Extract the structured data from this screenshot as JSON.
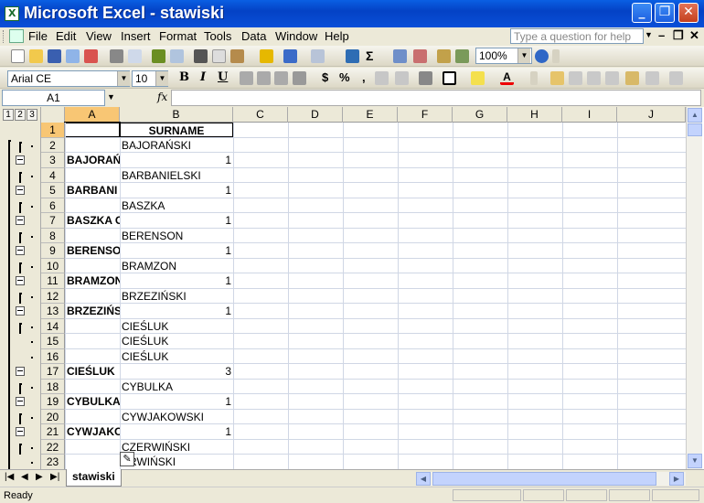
{
  "window": {
    "title": "Microsoft Excel - stawiski"
  },
  "menu": [
    "File",
    "Edit",
    "View",
    "Insert",
    "Format",
    "Tools",
    "Data",
    "Window",
    "Help"
  ],
  "help_placeholder": "Type a question for help",
  "toolbar": {
    "zoom": "100%",
    "font": "Arial CE",
    "size": "10",
    "bold": "B",
    "italic": "I",
    "underline": "U",
    "currency": "$",
    "percent": "%",
    "comma": ","
  },
  "formula": {
    "cell_ref": "A1",
    "fx": "fx",
    "value": ""
  },
  "outline_levels": [
    "1",
    "2",
    "3"
  ],
  "columns": [
    "A",
    "B",
    "C",
    "D",
    "E",
    "F",
    "G",
    "H",
    "I",
    "J"
  ],
  "rows": [
    {
      "n": "1",
      "a": "",
      "b": "SURNAME",
      "type": "header"
    },
    {
      "n": "2",
      "a": "",
      "b": "BAJORAŃSKI",
      "type": "detail"
    },
    {
      "n": "3",
      "a": "BAJORAŃ",
      "b": "1",
      "type": "total"
    },
    {
      "n": "4",
      "a": "",
      "b": "BARBANIELSKI",
      "type": "detail"
    },
    {
      "n": "5",
      "a": "BARBANI",
      "b": "1",
      "type": "total"
    },
    {
      "n": "6",
      "a": "",
      "b": "BASZKA",
      "type": "detail"
    },
    {
      "n": "7",
      "a": "BASZKA C",
      "b": "1",
      "type": "total"
    },
    {
      "n": "8",
      "a": "",
      "b": "BERENSON",
      "type": "detail"
    },
    {
      "n": "9",
      "a": "BERENSO",
      "b": "1",
      "type": "total"
    },
    {
      "n": "10",
      "a": "",
      "b": "BRAMZON",
      "type": "detail"
    },
    {
      "n": "11",
      "a": "BRAMZON",
      "b": "1",
      "type": "total"
    },
    {
      "n": "12",
      "a": "",
      "b": "BRZEZIŃSKI",
      "type": "detail"
    },
    {
      "n": "13",
      "a": "BRZEZIŃS",
      "b": "1",
      "type": "total"
    },
    {
      "n": "14",
      "a": "",
      "b": "CIEŚLUK",
      "type": "detail"
    },
    {
      "n": "15",
      "a": "",
      "b": "CIEŚLUK",
      "type": "detail"
    },
    {
      "n": "16",
      "a": "",
      "b": "CIEŚLUK",
      "type": "detail"
    },
    {
      "n": "17",
      "a": "CIEŚLUK",
      "b": "3",
      "type": "total"
    },
    {
      "n": "18",
      "a": "",
      "b": "CYBULKA",
      "type": "detail"
    },
    {
      "n": "19",
      "a": "CYBULKA",
      "b": "1",
      "type": "total"
    },
    {
      "n": "20",
      "a": "",
      "b": "CYWJAKOWSKI",
      "type": "detail"
    },
    {
      "n": "21",
      "a": "CYWJAKO",
      "b": "1",
      "type": "total"
    },
    {
      "n": "22",
      "a": "",
      "b": "CZERWIŃSKI",
      "type": "detail"
    },
    {
      "n": "23",
      "a": "",
      "b": "ERWIŃSKI",
      "type": "detail"
    }
  ],
  "sheet_tab": "stawiski",
  "status": "Ready"
}
